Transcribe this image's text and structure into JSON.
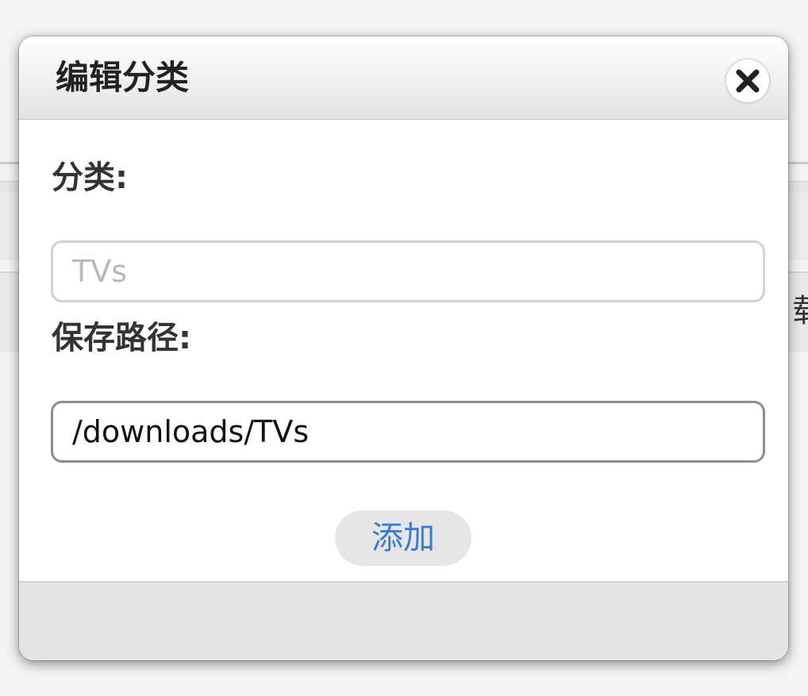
{
  "dialog": {
    "title": "编辑分类",
    "close_icon": "close-icon",
    "category_label": "分类:",
    "category_placeholder": "TVs",
    "category_value": "",
    "path_label": "保存路径:",
    "path_value": "/downloads/TVs",
    "add_label": "添加"
  },
  "background": {
    "peek_text": "载"
  },
  "colors": {
    "accent": "#3a7bd5",
    "header_gradient_top": "#ffffff",
    "header_gradient_bottom": "#e3e3e3"
  }
}
